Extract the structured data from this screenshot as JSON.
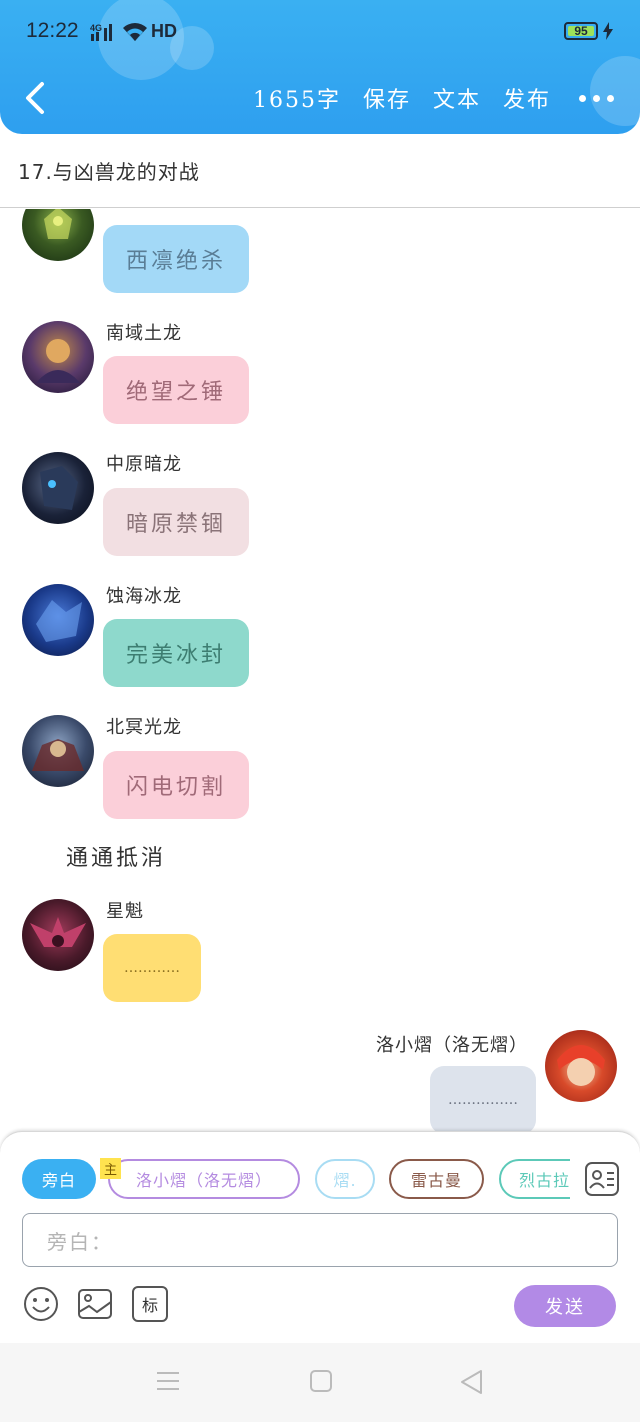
{
  "status_bar": {
    "time": "12:22",
    "signal_label": "4G",
    "network_label": "HD",
    "battery_level": "95"
  },
  "header": {
    "word_count": "1655字",
    "save_label": "保存",
    "text_label": "文本",
    "publish_label": "发布",
    "accent_color": "#2e9fef"
  },
  "chapter": {
    "title": "17.与凶兽龙的对战"
  },
  "messages": [
    {
      "speaker": "",
      "text": "西凛绝杀",
      "bubble_color": "#a3d9f7",
      "text_color": "#5a7d95"
    },
    {
      "speaker": "南域土龙",
      "text": "绝望之锤",
      "bubble_color": "#fbcfd9",
      "text_color": "#a06a78"
    },
    {
      "speaker": "中原暗龙",
      "text": "暗原禁锢",
      "bubble_color": "#f2dfe2",
      "text_color": "#8a7378"
    },
    {
      "speaker": "蚀海冰龙",
      "text": "完美冰封",
      "bubble_color": "#8ed9cc",
      "text_color": "#3d7d71"
    },
    {
      "speaker": "北冥光龙",
      "text": "闪电切割",
      "bubble_color": "#fbcfd9",
      "text_color": "#a06a78"
    },
    {
      "speaker": "星魁",
      "text": "…………",
      "bubble_color": "#ffde73",
      "text_color": "#8a6f20"
    },
    {
      "speaker": "洛小熠（洛无熠）",
      "text": "……………",
      "bubble_color": "#dde3ec",
      "text_color": "#6b7280"
    }
  ],
  "narration": "通通抵消",
  "input_panel": {
    "main_tag": "主",
    "chips": [
      {
        "label": "旁白",
        "style": "filled",
        "color": "#3ab0f2"
      },
      {
        "label": "洛小熠（洛无熠）",
        "style": "outline",
        "color": "#b48be0"
      },
      {
        "label": "熠.",
        "style": "outline",
        "color": "#a8dcf3"
      },
      {
        "label": "雷古曼",
        "style": "outline",
        "color": "#8a5a4a"
      },
      {
        "label": "烈古拉",
        "style": "outline",
        "color": "#5cc9b8"
      }
    ],
    "input_placeholder": "旁白：",
    "mark_label": "标",
    "send_label": "发送",
    "send_color": "#b28ae6"
  }
}
